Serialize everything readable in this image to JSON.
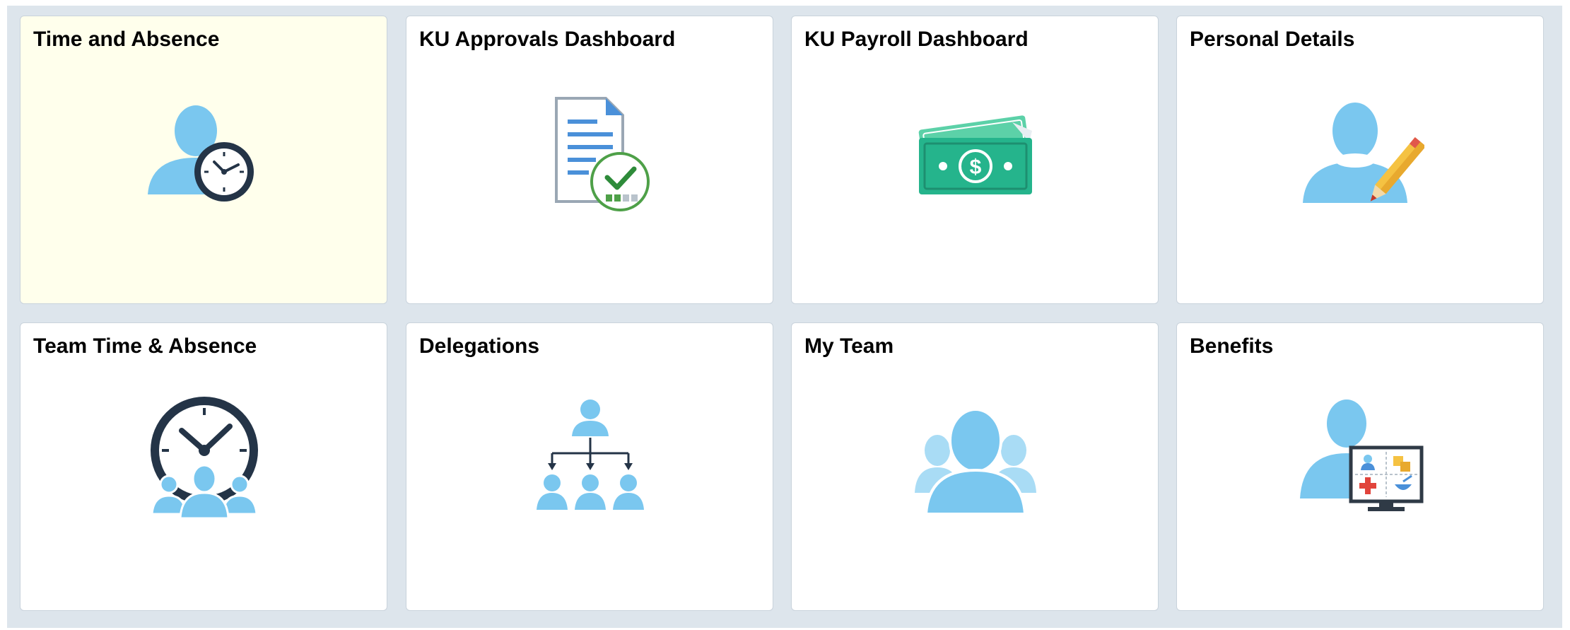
{
  "colors": {
    "background": "#dde5ec",
    "tile": "#ffffff",
    "tile_highlight": "#ffffec",
    "person_blue": "#7ac7ef",
    "dark_navy": "#243447",
    "money_green": "#25b48c",
    "check_green": "#4ea048"
  },
  "tiles": [
    {
      "title": "Time and Absence",
      "icon": "person-clock-icon",
      "highlighted": true
    },
    {
      "title": "KU Approvals Dashboard",
      "icon": "approved-document-icon",
      "highlighted": false
    },
    {
      "title": "KU Payroll Dashboard",
      "icon": "money-bills-icon",
      "highlighted": false
    },
    {
      "title": "Personal Details",
      "icon": "person-pencil-icon",
      "highlighted": false
    },
    {
      "title": "Team Time & Absence",
      "icon": "team-clock-icon",
      "highlighted": false
    },
    {
      "title": "Delegations",
      "icon": "org-chart-icon",
      "highlighted": false
    },
    {
      "title": "My Team",
      "icon": "team-people-icon",
      "highlighted": false
    },
    {
      "title": "Benefits",
      "icon": "person-benefits-monitor-icon",
      "highlighted": false
    }
  ]
}
